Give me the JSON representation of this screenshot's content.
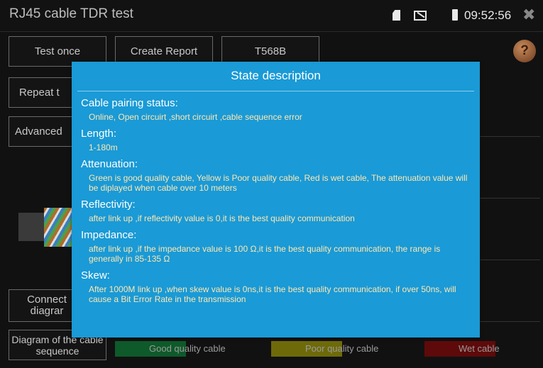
{
  "titlebar": {
    "title": "RJ45 cable TDR test",
    "time": "09:52:56"
  },
  "buttons": {
    "test_once": "Test once",
    "create_report": "Create Report",
    "t568b": "T568B",
    "repeat_test": "Repeat t",
    "advanced": "Advanced",
    "connect_diagram": "Connect diagrar",
    "diagram_of_cable_sequence": "Diagram of the cable sequence"
  },
  "legend": [
    {
      "label": "Good quality cable",
      "color": "#0e5a2a"
    },
    {
      "label": "Poor quality cable",
      "color": "#6e6a0a"
    },
    {
      "label": "Wet cable",
      "color": "#5e0a0a"
    }
  ],
  "modal": {
    "title": "State description",
    "sections": [
      {
        "title": "Cable pairing status:",
        "text": "Online, Open circuirt ,short circuirt ,cable sequence error"
      },
      {
        "title": "Length:",
        "text": "1-180m"
      },
      {
        "title": "Attenuation:",
        "text": "Green is good quality cable, Yellow is Poor quality cable, Red is wet cable, The attenuation value will be diplayed when cable over 10 meters"
      },
      {
        "title": "Reflectivity:",
        "text": "after link up ,if reflectivity value is 0,it is the best quality communication"
      },
      {
        "title": "Impedance:",
        "text": "after link up ,if the impedance value is 100 Ω,it is the best quality communication, the range is generally in 85-135 Ω"
      },
      {
        "title": "Skew:",
        "text": "After 1000M link up ,when skew value is 0ns,it is the best quality communication, if over 50ns, will cause a Bit Error Rate in the transmission"
      }
    ]
  },
  "colors": {
    "modal_bg": "#1a9ad6",
    "modal_text": "#ffe7b0"
  },
  "icons": [
    "sd-card-icon",
    "cast-icon",
    "battery-icon",
    "close-icon",
    "help-book-icon"
  ]
}
